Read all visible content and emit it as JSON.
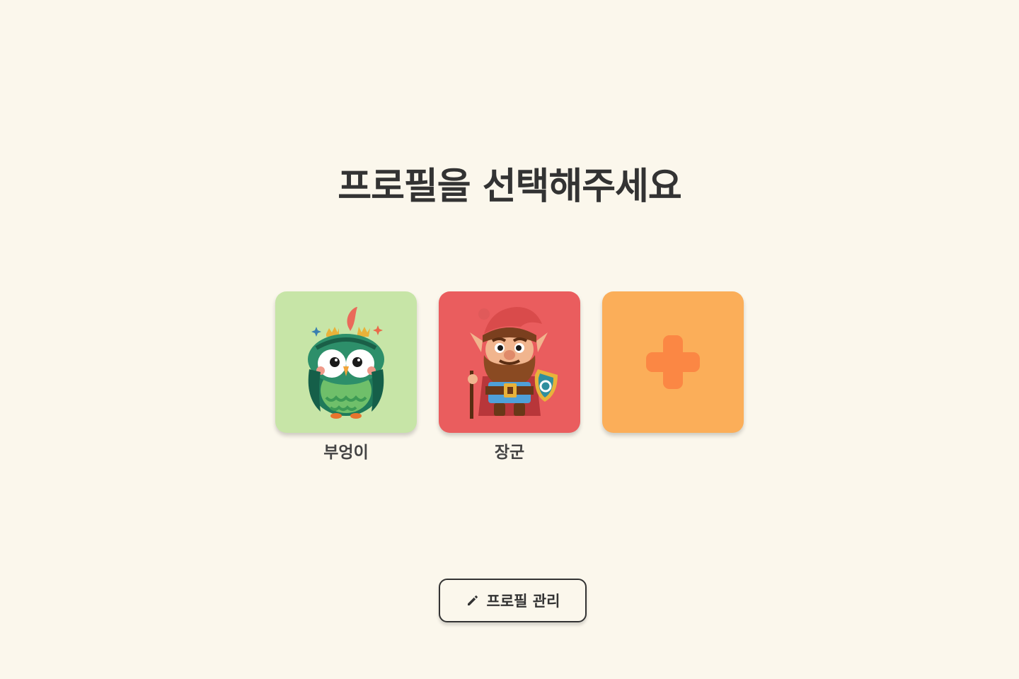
{
  "page": {
    "title": "프로필을 선택해주세요",
    "background": "#fbf7ec"
  },
  "profiles": [
    {
      "name": "부엉이",
      "avatar": "owl-avatar",
      "tile_color": "#c7e5a7"
    },
    {
      "name": "장군",
      "avatar": "dwarf-warrior-avatar",
      "tile_color": "#ea5d5e"
    }
  ],
  "add_profile": {
    "icon": "plus-icon",
    "tile_color": "#fbae59",
    "icon_color": "#fb8744"
  },
  "manage_button": {
    "icon": "pencil-icon",
    "label": "프로필 관리"
  }
}
